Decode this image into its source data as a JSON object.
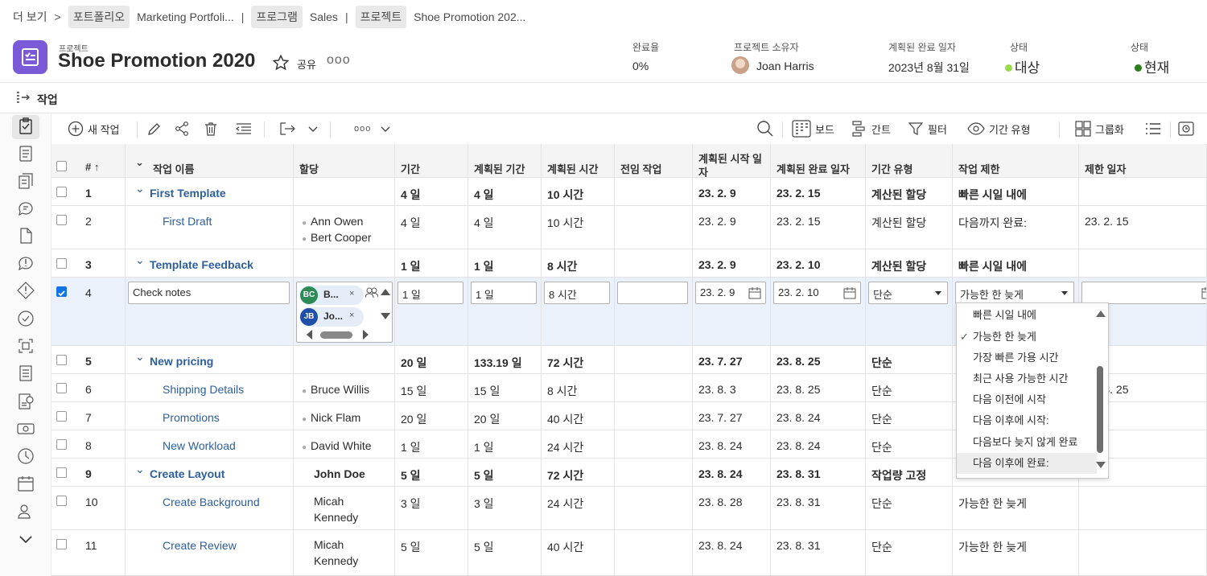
{
  "breadcrumb": [
    {
      "label": "더 보기",
      "type": "text"
    },
    {
      "label": ">",
      "type": "sep"
    },
    {
      "label": "포트폴리오",
      "type": "chip"
    },
    {
      "label": "Marketing Portfoli...",
      "type": "text"
    },
    {
      "label": "|",
      "type": "sep"
    },
    {
      "label": "프로그램",
      "type": "chip"
    },
    {
      "label": "Sales",
      "type": "text"
    },
    {
      "label": "|",
      "type": "sep"
    },
    {
      "label": "프로젝트",
      "type": "chip"
    },
    {
      "label": "Shoe Promotion 202...",
      "type": "text"
    }
  ],
  "project": {
    "kind": "프로젝트",
    "title": "Shoe Promotion 2020",
    "share_label": "공유",
    "more_label": "ooo",
    "accent": "#7b5ad8"
  },
  "meta": {
    "completion_label": "완료율",
    "completion_value": "0%",
    "owner_label": "프로젝트 소유자",
    "owner_value": "Joan Harris",
    "planned_end_label": "계획된 완료 일자",
    "planned_end_value": "2023년 8월 31일",
    "status1_label": "상태",
    "status1_value": "대상",
    "status1_color": "#9adb4c",
    "status2_label": "상태",
    "status2_value": "현재",
    "status2_color": "#2d7d1e"
  },
  "tab": {
    "label": "작업"
  },
  "toolbar": {
    "new_task": "새 작업",
    "board": "보드",
    "gantt": "간트",
    "filter": "필터",
    "duration_type": "기간 유형",
    "group": "그룹화",
    "more": "ooo"
  },
  "table": {
    "headers": [
      "#",
      "작업 이름",
      "할당",
      "기간",
      "계획된 기간",
      "계획된 시간",
      "전임 작업",
      "계획된 시작 일자",
      "계획된 완료 일자",
      "기간 유형",
      "작업 제한",
      "제한 일자"
    ],
    "sort_icon": "↑",
    "rows": [
      {
        "num": "1",
        "name": "First Template",
        "assign": [],
        "dur": "4 일",
        "pdur": "4 일",
        "phours": "10 시간",
        "pred": "",
        "start": "23. 2. 9",
        "end": "23. 2. 15",
        "dtype": "계산된 할당",
        "constraint": "빠른 시일 내에",
        "cdate": "",
        "parent": true
      },
      {
        "num": "2",
        "name": "First Draft",
        "assign": [
          "Ann Owen",
          "Bert Cooper"
        ],
        "dur": "4 일",
        "pdur": "4 일",
        "phours": "10 시간",
        "pred": "",
        "start": "23. 2. 9",
        "end": "23. 2. 15",
        "dtype": "계산된 할당",
        "constraint": "다음까지 완료:",
        "cdate": "23. 2. 15",
        "parent": false
      },
      {
        "num": "3",
        "name": "Template Feedback",
        "assign": [],
        "dur": "1 일",
        "pdur": "1 일",
        "phours": "8 시간",
        "pred": "",
        "start": "23. 2. 9",
        "end": "23. 2. 10",
        "dtype": "계산된 할당",
        "constraint": "빠른 시일 내에",
        "cdate": "",
        "parent": true
      },
      {
        "num": "5",
        "name": "New pricing",
        "assign": [],
        "dur": "20 일",
        "pdur": "133.19 일",
        "phours": "72 시간",
        "pred": "",
        "start": "23. 7. 27",
        "end": "23. 8. 25",
        "dtype": "단순",
        "constraint": "",
        "cdate": "",
        "parent": true
      },
      {
        "num": "6",
        "name": "Shipping Details",
        "assign": [
          "Bruce Willis"
        ],
        "dur": "15 일",
        "pdur": "15 일",
        "phours": "8 시간",
        "pred": "",
        "start": "23. 8. 3",
        "end": "23. 8. 25",
        "dtype": "단순",
        "constraint": "",
        "cdate": "23. 8. 25",
        "parent": false
      },
      {
        "num": "7",
        "name": "Promotions",
        "assign": [
          "Nick Flam"
        ],
        "dur": "20 일",
        "pdur": "20 일",
        "phours": "40 시간",
        "pred": "",
        "start": "23. 7. 27",
        "end": "23. 8. 24",
        "dtype": "단순",
        "constraint": "",
        "cdate": "",
        "parent": false
      },
      {
        "num": "8",
        "name": "New Workload",
        "assign": [
          "David White"
        ],
        "dur": "1 일",
        "pdur": "1 일",
        "phours": "24 시간",
        "pred": "",
        "start": "23. 8. 24",
        "end": "23. 8. 24",
        "dtype": "단순",
        "constraint": "",
        "cdate": "",
        "parent": false
      },
      {
        "num": "9",
        "name": "Create Layout",
        "assign": [
          "John Doe"
        ],
        "dur": "5 일",
        "pdur": "5 일",
        "phours": "72 시간",
        "pred": "",
        "start": "23. 8. 24",
        "end": "23. 8. 31",
        "dtype": "작업량 고정",
        "constraint": "",
        "cdate": "",
        "parent": true
      },
      {
        "num": "10",
        "name": "Create Background",
        "assign": [
          "Micah",
          "Kennedy"
        ],
        "dur": "3 일",
        "pdur": "3 일",
        "phours": "24 시간",
        "pred": "",
        "start": "23. 8. 28",
        "end": "23. 8. 31",
        "dtype": "단순",
        "constraint": "가능한 한 늦게",
        "cdate": "",
        "parent": false
      },
      {
        "num": "11",
        "name": "Create Review",
        "assign": [
          "Micah",
          "Kennedy"
        ],
        "dur": "5 일",
        "pdur": "5 일",
        "phours": "40 시간",
        "pred": "",
        "start": "23. 8. 24",
        "end": "23. 8. 31",
        "dtype": "단순",
        "constraint": "가능한 한 늦게",
        "cdate": "",
        "parent": false
      }
    ],
    "edit_row": {
      "num": "4",
      "name": "Check notes",
      "assignees": [
        {
          "initials": "BC",
          "short": "B...",
          "color": "#2e8b57"
        },
        {
          "initials": "JB",
          "short": "Jo...",
          "color": "#1f4fa8"
        }
      ],
      "remove_label": "×",
      "dur": "1 일",
      "pdur": "1 일",
      "phours": "8 시간",
      "pred": "",
      "start": "23. 2. 9",
      "end": "23. 2. 10",
      "dtype": "단순",
      "constraint": "가능한 한 늦게",
      "cdate": ""
    }
  },
  "dropdown": {
    "options": [
      "빠른 시일 내에",
      "가능한 한 늦게",
      "가장 빠른 가용 시간",
      "최근 사용 가능한 시간",
      "다음 이전에 시작",
      "다음 이후에 시작:",
      "다음보다 늦지 않게 완료",
      "다음 이후에 완료:"
    ],
    "checked_index": 1,
    "hover_index": 7,
    "check_mark": "✓"
  }
}
